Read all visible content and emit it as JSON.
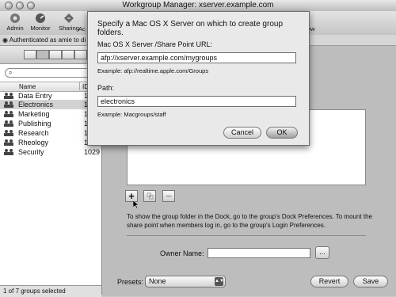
{
  "window": {
    "title": "Workgroup Manager: xserver.example.com"
  },
  "toolbar": {
    "items": [
      {
        "label": "Admin",
        "icon": "admin-icon"
      },
      {
        "label": "Monitor",
        "icon": "monitor-icon"
      },
      {
        "label": "Sharing",
        "icon": "sharing-icon"
      },
      {
        "label": "Ac",
        "icon": "accounts-icon"
      },
      {
        "label": "ow",
        "icon": "overview-icon"
      }
    ]
  },
  "auth": {
    "text": "Authenticated as amie to di"
  },
  "sidebar": {
    "columns": {
      "name": "Name",
      "id": "ID"
    },
    "groups": [
      {
        "name": "Data Entry",
        "id": "1"
      },
      {
        "name": "Electronics",
        "id": "1",
        "selected": true
      },
      {
        "name": "Marketing",
        "id": "1"
      },
      {
        "name": "Publishing",
        "id": "1"
      },
      {
        "name": "Research",
        "id": "1"
      },
      {
        "name": "Rheology",
        "id": "1"
      },
      {
        "name": "Security",
        "id": "1029"
      }
    ],
    "status": "1 of 7 groups selected"
  },
  "sheet": {
    "title": "Specify a Mac OS X Server on which to create group folders.",
    "url_label": "Mac OS X Server /Share Point URL:",
    "url_value": "afp://xserver.example.com/mygroups",
    "url_example": "Example: afp://realtime.apple.com/Groups",
    "path_label": "Path:",
    "path_value": "electronics",
    "path_example": "Example: Macgroups/staff",
    "cancel": "Cancel",
    "ok": "OK"
  },
  "main": {
    "add_symbol": "+",
    "remove_symbol": "−",
    "info": "To show the group folder in the Dock, go to the group's Dock Preferences. To mount the share point when members log in, go to the group's Login Preferences.",
    "owner_label": "Owner Name:",
    "owner_value": "",
    "browse": "...",
    "presets_label": "Presets:",
    "presets_value": "None",
    "revert": "Revert",
    "save": "Save"
  }
}
